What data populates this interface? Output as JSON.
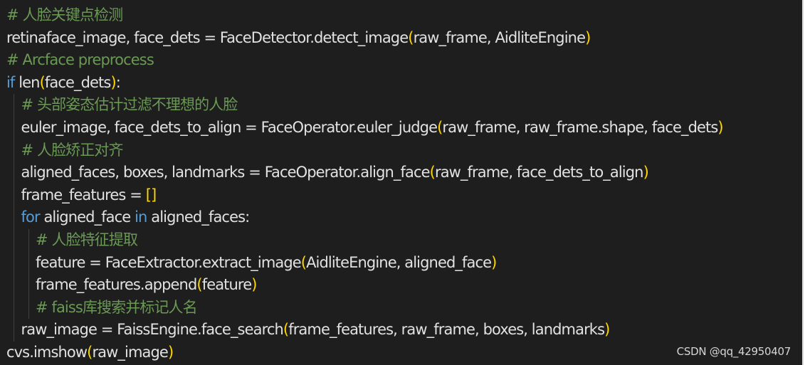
{
  "colors": {
    "background": "#1e1e1e",
    "plain": "#e2e2e2",
    "comment": "#6a9955",
    "keyword": "#569cd6",
    "bracket": "#ffd700"
  },
  "code_lines": [
    {
      "indent": 0,
      "tokens": [
        {
          "type": "comment",
          "text": "# 人脸关键点检测"
        }
      ]
    },
    {
      "indent": 0,
      "tokens": [
        {
          "type": "plain",
          "text": "retinaface_image, face_dets = FaceDetector.detect_image"
        },
        {
          "type": "bracket",
          "text": "("
        },
        {
          "type": "plain",
          "text": "raw_frame, AidliteEngine"
        },
        {
          "type": "bracket",
          "text": ")"
        }
      ]
    },
    {
      "indent": 0,
      "tokens": [
        {
          "type": "comment",
          "text": "# Arcface preprocess"
        }
      ]
    },
    {
      "indent": 0,
      "tokens": [
        {
          "type": "keyword",
          "text": "if"
        },
        {
          "type": "plain",
          "text": " len"
        },
        {
          "type": "bracket",
          "text": "("
        },
        {
          "type": "plain",
          "text": "face_dets"
        },
        {
          "type": "bracket",
          "text": ")"
        },
        {
          "type": "plain",
          "text": ":"
        }
      ]
    },
    {
      "indent": 1,
      "tokens": [
        {
          "type": "comment",
          "text": "# 头部姿态估计过滤不理想的人脸"
        }
      ]
    },
    {
      "indent": 1,
      "tokens": [
        {
          "type": "plain",
          "text": "euler_image, face_dets_to_align = FaceOperator.euler_judge"
        },
        {
          "type": "bracket",
          "text": "("
        },
        {
          "type": "plain",
          "text": "raw_frame, raw_frame.shape, face_dets"
        },
        {
          "type": "bracket",
          "text": ")"
        }
      ]
    },
    {
      "indent": 1,
      "tokens": [
        {
          "type": "comment",
          "text": "# 人脸矫正对齐"
        }
      ]
    },
    {
      "indent": 1,
      "tokens": [
        {
          "type": "plain",
          "text": "aligned_faces, boxes, landmarks = FaceOperator.align_face"
        },
        {
          "type": "bracket",
          "text": "("
        },
        {
          "type": "plain",
          "text": "raw_frame, face_dets_to_align"
        },
        {
          "type": "bracket",
          "text": ")"
        }
      ]
    },
    {
      "indent": 1,
      "tokens": [
        {
          "type": "plain",
          "text": "frame_features = "
        },
        {
          "type": "bracket",
          "text": "[]"
        }
      ]
    },
    {
      "indent": 1,
      "tokens": [
        {
          "type": "keyword",
          "text": "for"
        },
        {
          "type": "plain",
          "text": " aligned_face "
        },
        {
          "type": "keyword",
          "text": "in"
        },
        {
          "type": "plain",
          "text": " aligned_faces:"
        }
      ]
    },
    {
      "indent": 2,
      "tokens": [
        {
          "type": "comment",
          "text": "# 人脸特征提取"
        }
      ]
    },
    {
      "indent": 2,
      "tokens": [
        {
          "type": "plain",
          "text": "feature = FaceExtractor.extract_image"
        },
        {
          "type": "bracket",
          "text": "("
        },
        {
          "type": "plain",
          "text": "AidliteEngine, aligned_face"
        },
        {
          "type": "bracket",
          "text": ")"
        }
      ]
    },
    {
      "indent": 2,
      "tokens": [
        {
          "type": "plain",
          "text": "frame_features.append"
        },
        {
          "type": "bracket",
          "text": "("
        },
        {
          "type": "plain",
          "text": "feature"
        },
        {
          "type": "bracket",
          "text": ")"
        }
      ]
    },
    {
      "indent": 2,
      "tokens": [
        {
          "type": "comment",
          "text": "# faiss库搜索并标记人名"
        }
      ]
    },
    {
      "indent": 1,
      "tokens": [
        {
          "type": "plain",
          "text": "raw_image = FaissEngine.face_search"
        },
        {
          "type": "bracket",
          "text": "("
        },
        {
          "type": "plain",
          "text": "frame_features, raw_frame, boxes, landmarks"
        },
        {
          "type": "bracket",
          "text": ")"
        }
      ]
    },
    {
      "indent": 0,
      "tokens": [
        {
          "type": "plain",
          "text": "cvs.imshow"
        },
        {
          "type": "bracket",
          "text": "("
        },
        {
          "type": "plain",
          "text": "raw_image"
        },
        {
          "type": "bracket",
          "text": ")"
        }
      ]
    }
  ],
  "watermark": "CSDN @qq_42950407"
}
